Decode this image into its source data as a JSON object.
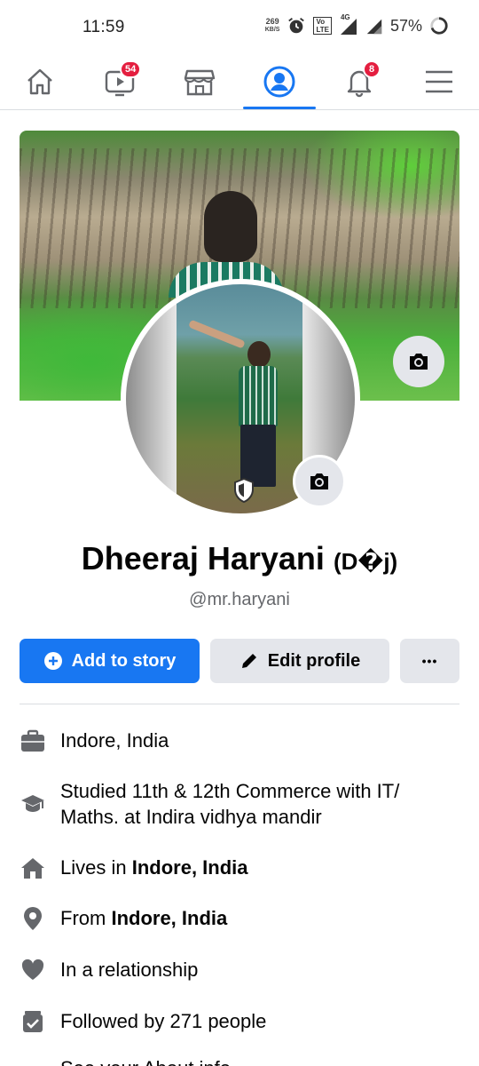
{
  "status_bar": {
    "time": "11:59",
    "net_speed_value": "269",
    "net_speed_unit": "KB/S",
    "volte_top": "Vo",
    "volte_bottom": "LTE",
    "network": "4G",
    "battery": "57%"
  },
  "nav": {
    "items": [
      {
        "name": "home",
        "icon": "home-icon"
      },
      {
        "name": "watch",
        "icon": "video-icon",
        "badge": "54"
      },
      {
        "name": "marketplace",
        "icon": "store-icon"
      },
      {
        "name": "profile",
        "icon": "profile-icon",
        "active": true
      },
      {
        "name": "notifications",
        "icon": "bell-icon",
        "badge": "8"
      },
      {
        "name": "menu",
        "icon": "hamburger-icon"
      }
    ]
  },
  "profile": {
    "name": "Dheeraj Haryani",
    "nickname": "(D�j)",
    "handle": "@mr.haryani"
  },
  "actions": {
    "add_story": "Add to story",
    "edit_profile": "Edit profile",
    "more": "•••"
  },
  "info": {
    "work": "Indore, India",
    "education": "Studied 11th & 12th Commerce with IT/ Maths. at Indira vidhya mandir",
    "lives_prefix": "Lives in ",
    "lives_place": "Indore, India",
    "from_prefix": "From ",
    "from_place": "Indore, India",
    "relationship": "In a relationship",
    "followers": "Followed by 271 people",
    "about_link": "See your About info"
  },
  "colors": {
    "accent": "#1877f2",
    "badge": "#e41e3f",
    "icon_gray": "#65676b",
    "button_gray": "#e4e6eb"
  }
}
